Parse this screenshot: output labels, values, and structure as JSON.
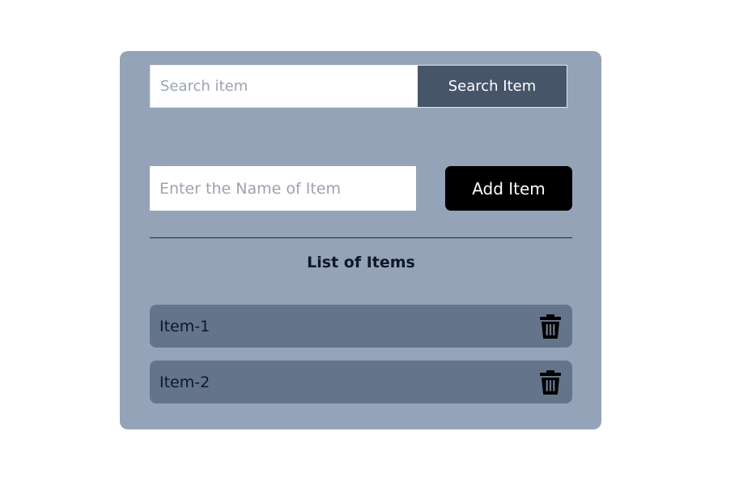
{
  "search": {
    "placeholder": "Search item",
    "value": "",
    "button_label": "Search Item"
  },
  "add": {
    "placeholder": "Enter the Name of Item",
    "value": "",
    "button_label": "Add Item"
  },
  "list": {
    "title": "List of Items",
    "items": [
      {
        "label": "Item-1",
        "icon": "trash-icon"
      },
      {
        "label": "Item-2",
        "icon": "trash-icon"
      }
    ]
  },
  "colors": {
    "card_background": "#94a3b8",
    "item_background": "#64748b",
    "search_button": "#475569",
    "add_button": "#000000"
  }
}
